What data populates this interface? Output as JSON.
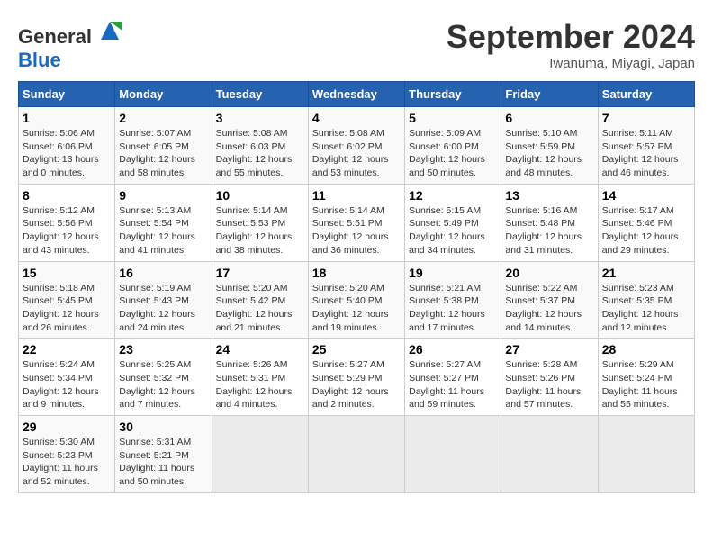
{
  "header": {
    "logo_general": "General",
    "logo_blue": "Blue",
    "month": "September 2024",
    "location": "Iwanuma, Miyagi, Japan"
  },
  "weekdays": [
    "Sunday",
    "Monday",
    "Tuesday",
    "Wednesday",
    "Thursday",
    "Friday",
    "Saturday"
  ],
  "weeks": [
    [
      {
        "day": 1,
        "info": "Sunrise: 5:06 AM\nSunset: 6:06 PM\nDaylight: 13 hours\nand 0 minutes."
      },
      {
        "day": 2,
        "info": "Sunrise: 5:07 AM\nSunset: 6:05 PM\nDaylight: 12 hours\nand 58 minutes."
      },
      {
        "day": 3,
        "info": "Sunrise: 5:08 AM\nSunset: 6:03 PM\nDaylight: 12 hours\nand 55 minutes."
      },
      {
        "day": 4,
        "info": "Sunrise: 5:08 AM\nSunset: 6:02 PM\nDaylight: 12 hours\nand 53 minutes."
      },
      {
        "day": 5,
        "info": "Sunrise: 5:09 AM\nSunset: 6:00 PM\nDaylight: 12 hours\nand 50 minutes."
      },
      {
        "day": 6,
        "info": "Sunrise: 5:10 AM\nSunset: 5:59 PM\nDaylight: 12 hours\nand 48 minutes."
      },
      {
        "day": 7,
        "info": "Sunrise: 5:11 AM\nSunset: 5:57 PM\nDaylight: 12 hours\nand 46 minutes."
      }
    ],
    [
      {
        "day": 8,
        "info": "Sunrise: 5:12 AM\nSunset: 5:56 PM\nDaylight: 12 hours\nand 43 minutes."
      },
      {
        "day": 9,
        "info": "Sunrise: 5:13 AM\nSunset: 5:54 PM\nDaylight: 12 hours\nand 41 minutes."
      },
      {
        "day": 10,
        "info": "Sunrise: 5:14 AM\nSunset: 5:53 PM\nDaylight: 12 hours\nand 38 minutes."
      },
      {
        "day": 11,
        "info": "Sunrise: 5:14 AM\nSunset: 5:51 PM\nDaylight: 12 hours\nand 36 minutes."
      },
      {
        "day": 12,
        "info": "Sunrise: 5:15 AM\nSunset: 5:49 PM\nDaylight: 12 hours\nand 34 minutes."
      },
      {
        "day": 13,
        "info": "Sunrise: 5:16 AM\nSunset: 5:48 PM\nDaylight: 12 hours\nand 31 minutes."
      },
      {
        "day": 14,
        "info": "Sunrise: 5:17 AM\nSunset: 5:46 PM\nDaylight: 12 hours\nand 29 minutes."
      }
    ],
    [
      {
        "day": 15,
        "info": "Sunrise: 5:18 AM\nSunset: 5:45 PM\nDaylight: 12 hours\nand 26 minutes."
      },
      {
        "day": 16,
        "info": "Sunrise: 5:19 AM\nSunset: 5:43 PM\nDaylight: 12 hours\nand 24 minutes."
      },
      {
        "day": 17,
        "info": "Sunrise: 5:20 AM\nSunset: 5:42 PM\nDaylight: 12 hours\nand 21 minutes."
      },
      {
        "day": 18,
        "info": "Sunrise: 5:20 AM\nSunset: 5:40 PM\nDaylight: 12 hours\nand 19 minutes."
      },
      {
        "day": 19,
        "info": "Sunrise: 5:21 AM\nSunset: 5:38 PM\nDaylight: 12 hours\nand 17 minutes."
      },
      {
        "day": 20,
        "info": "Sunrise: 5:22 AM\nSunset: 5:37 PM\nDaylight: 12 hours\nand 14 minutes."
      },
      {
        "day": 21,
        "info": "Sunrise: 5:23 AM\nSunset: 5:35 PM\nDaylight: 12 hours\nand 12 minutes."
      }
    ],
    [
      {
        "day": 22,
        "info": "Sunrise: 5:24 AM\nSunset: 5:34 PM\nDaylight: 12 hours\nand 9 minutes."
      },
      {
        "day": 23,
        "info": "Sunrise: 5:25 AM\nSunset: 5:32 PM\nDaylight: 12 hours\nand 7 minutes."
      },
      {
        "day": 24,
        "info": "Sunrise: 5:26 AM\nSunset: 5:31 PM\nDaylight: 12 hours\nand 4 minutes."
      },
      {
        "day": 25,
        "info": "Sunrise: 5:27 AM\nSunset: 5:29 PM\nDaylight: 12 hours\nand 2 minutes."
      },
      {
        "day": 26,
        "info": "Sunrise: 5:27 AM\nSunset: 5:27 PM\nDaylight: 11 hours\nand 59 minutes."
      },
      {
        "day": 27,
        "info": "Sunrise: 5:28 AM\nSunset: 5:26 PM\nDaylight: 11 hours\nand 57 minutes."
      },
      {
        "day": 28,
        "info": "Sunrise: 5:29 AM\nSunset: 5:24 PM\nDaylight: 11 hours\nand 55 minutes."
      }
    ],
    [
      {
        "day": 29,
        "info": "Sunrise: 5:30 AM\nSunset: 5:23 PM\nDaylight: 11 hours\nand 52 minutes."
      },
      {
        "day": 30,
        "info": "Sunrise: 5:31 AM\nSunset: 5:21 PM\nDaylight: 11 hours\nand 50 minutes."
      },
      {
        "day": null,
        "info": ""
      },
      {
        "day": null,
        "info": ""
      },
      {
        "day": null,
        "info": ""
      },
      {
        "day": null,
        "info": ""
      },
      {
        "day": null,
        "info": ""
      }
    ]
  ]
}
